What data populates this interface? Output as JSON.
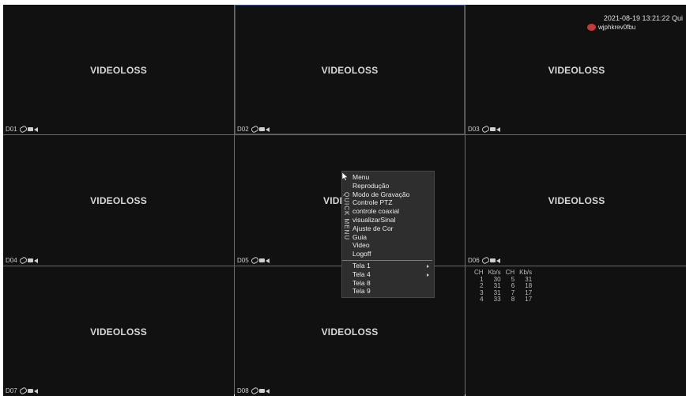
{
  "status": {
    "datetime": "2021-08-19 13:21:22 Qui",
    "user": "wjphkrev0fbu",
    "user_icon": "user-icon"
  },
  "grid": {
    "cells": [
      {
        "video": "VIDEOLOSS",
        "label": "D01"
      },
      {
        "video": "VIDEOLOSS",
        "label": "D02"
      },
      {
        "video": "VIDEOLOSS",
        "label": "D03"
      },
      {
        "video": "VIDEOLOSS",
        "label": "D04"
      },
      {
        "video": "VIDE",
        "label": "D05"
      },
      {
        "video": "VIDEOLOSS",
        "label": "D06"
      },
      {
        "video": "VIDEOLOSS",
        "label": "D07"
      },
      {
        "video": "VIDEOLOSS",
        "label": "D08"
      }
    ]
  },
  "bitrate": {
    "headers": [
      "CH",
      "Kb/s",
      "CH",
      "Kb/s"
    ],
    "rows": [
      [
        "1",
        "30",
        "5",
        "31"
      ],
      [
        "2",
        "31",
        "6",
        "18"
      ],
      [
        "3",
        "31",
        "7",
        "17"
      ],
      [
        "4",
        "33",
        "8",
        "17"
      ]
    ]
  },
  "quick_menu": {
    "title": "QUICK MENU",
    "items": [
      "Menu",
      "Reprodução",
      "Modo de Gravação",
      "Controle PTZ",
      "controle coaxial",
      "visualizarSinal",
      "Ajuste de Cor",
      "Guia",
      "Video",
      "Logoff"
    ],
    "layout_items": [
      "Tela 1",
      "Tela 4",
      "Tela 8",
      "Tela 9"
    ]
  }
}
